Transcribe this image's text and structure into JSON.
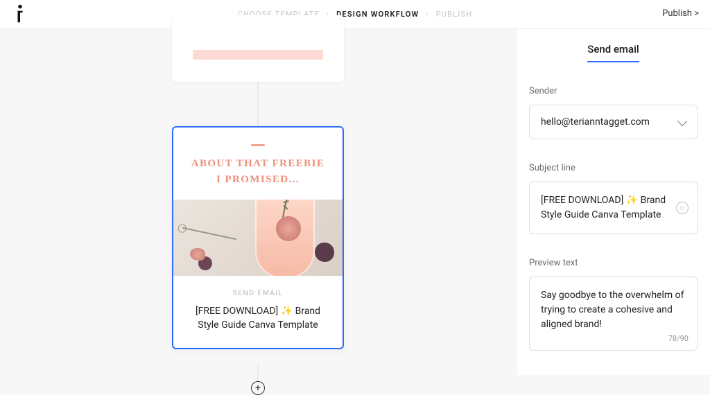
{
  "breadcrumb": {
    "step1": "Choose Template",
    "step2": "Design Workflow",
    "step3": "Publish"
  },
  "topbar": {
    "publish": "Publish >"
  },
  "card": {
    "headline": "ABOUT THAT FREEBIE I PROMISED...",
    "tag": "SEND EMAIL",
    "title": "[FREE DOWNLOAD] ✨ Brand Style Guide Canva Template"
  },
  "panel": {
    "tab": "Send email",
    "sender_label": "Sender",
    "sender_value": "hello@terianntagget.com",
    "subject_label": "Subject line",
    "subject_value": "[FREE DOWNLOAD] ✨ Brand Style Guide Canva Template",
    "preview_label": "Preview text",
    "preview_value": "Say goodbye to the overwhelm of trying to create a cohesive and aligned brand!",
    "preview_counter": "78/90"
  }
}
